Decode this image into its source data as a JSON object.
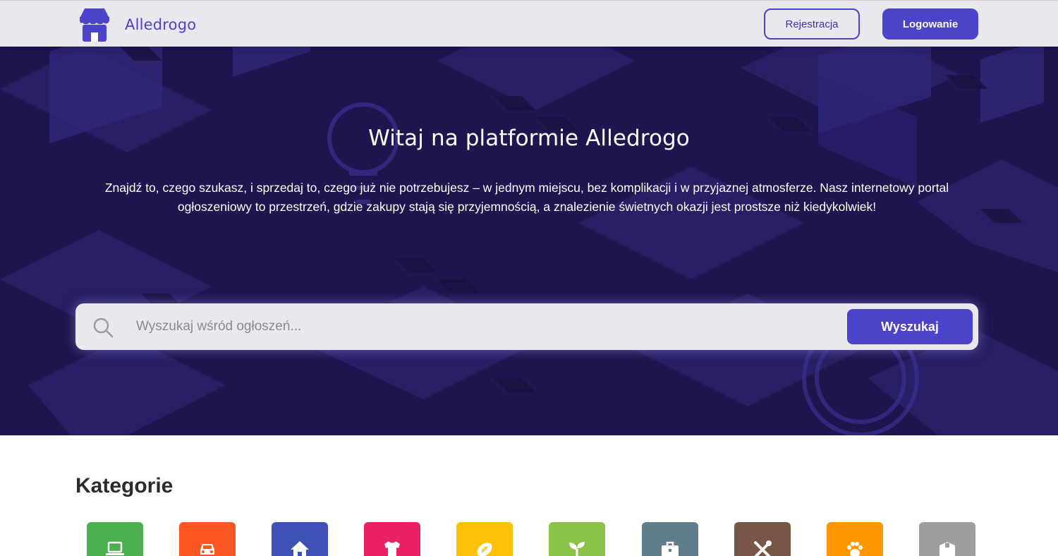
{
  "header": {
    "brand": "Alledrogo",
    "register_label": "Rejestracja",
    "login_label": "Logowanie",
    "logo_icon": "store-icon",
    "accent_color": "#4b43c9"
  },
  "hero": {
    "title": "Witaj na platformie Alledrogo",
    "description": "Znajdź to, czego szukasz, i sprzedaj to, czego już nie potrzebujesz – w jednym miejscu, bez komplikacji i w przyjaznej atmosferze. Nasz internetowy portal ogłoszeniowy to przestrzeń, gdzie zakupy stają się przyjemnością, a znalezienie świetnych okazji jest prostsze niż kiedykolwiek!",
    "background_color": "#1f1650"
  },
  "search": {
    "placeholder": "Wyszukaj wśród ogłoszeń...",
    "value": "",
    "button_label": "Wyszukaj",
    "icon": "search-icon"
  },
  "categories": {
    "title": "Kategorie",
    "items": [
      {
        "icon": "laptop-icon",
        "color": "#4caf50"
      },
      {
        "icon": "car-icon",
        "color": "#ff5722"
      },
      {
        "icon": "home-icon",
        "color": "#3f51b5"
      },
      {
        "icon": "tshirt-icon",
        "color": "#e91e63"
      },
      {
        "icon": "football-icon",
        "color": "#ffc107"
      },
      {
        "icon": "seedling-icon",
        "color": "#8bc34a"
      },
      {
        "icon": "briefcase-icon",
        "color": "#607d8b"
      },
      {
        "icon": "tools-icon",
        "color": "#795548"
      },
      {
        "icon": "paw-icon",
        "color": "#ff9800"
      },
      {
        "icon": "box-icon",
        "color": "#9e9e9e"
      }
    ]
  }
}
